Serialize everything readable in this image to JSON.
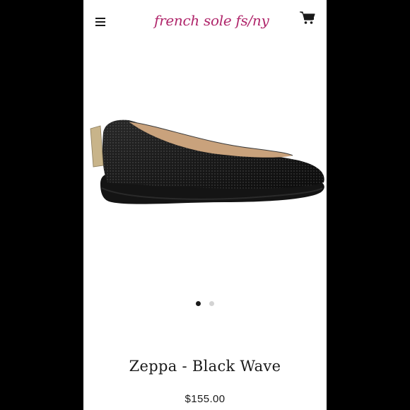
{
  "header": {
    "logo_text": "french sole fs/ny",
    "menu_icon": "hamburger-menu-icon",
    "cart_icon": "cart-icon"
  },
  "product": {
    "title": "Zeppa - Black Wave",
    "price": "$155.00",
    "image_subject": "black textured wedge flat shoe",
    "gallery": {
      "total_images": 2,
      "active_index": 0
    }
  },
  "colors": {
    "brand": "#b0266b",
    "text": "#1a1a1a",
    "background": "#ffffff",
    "frame": "#000000"
  }
}
